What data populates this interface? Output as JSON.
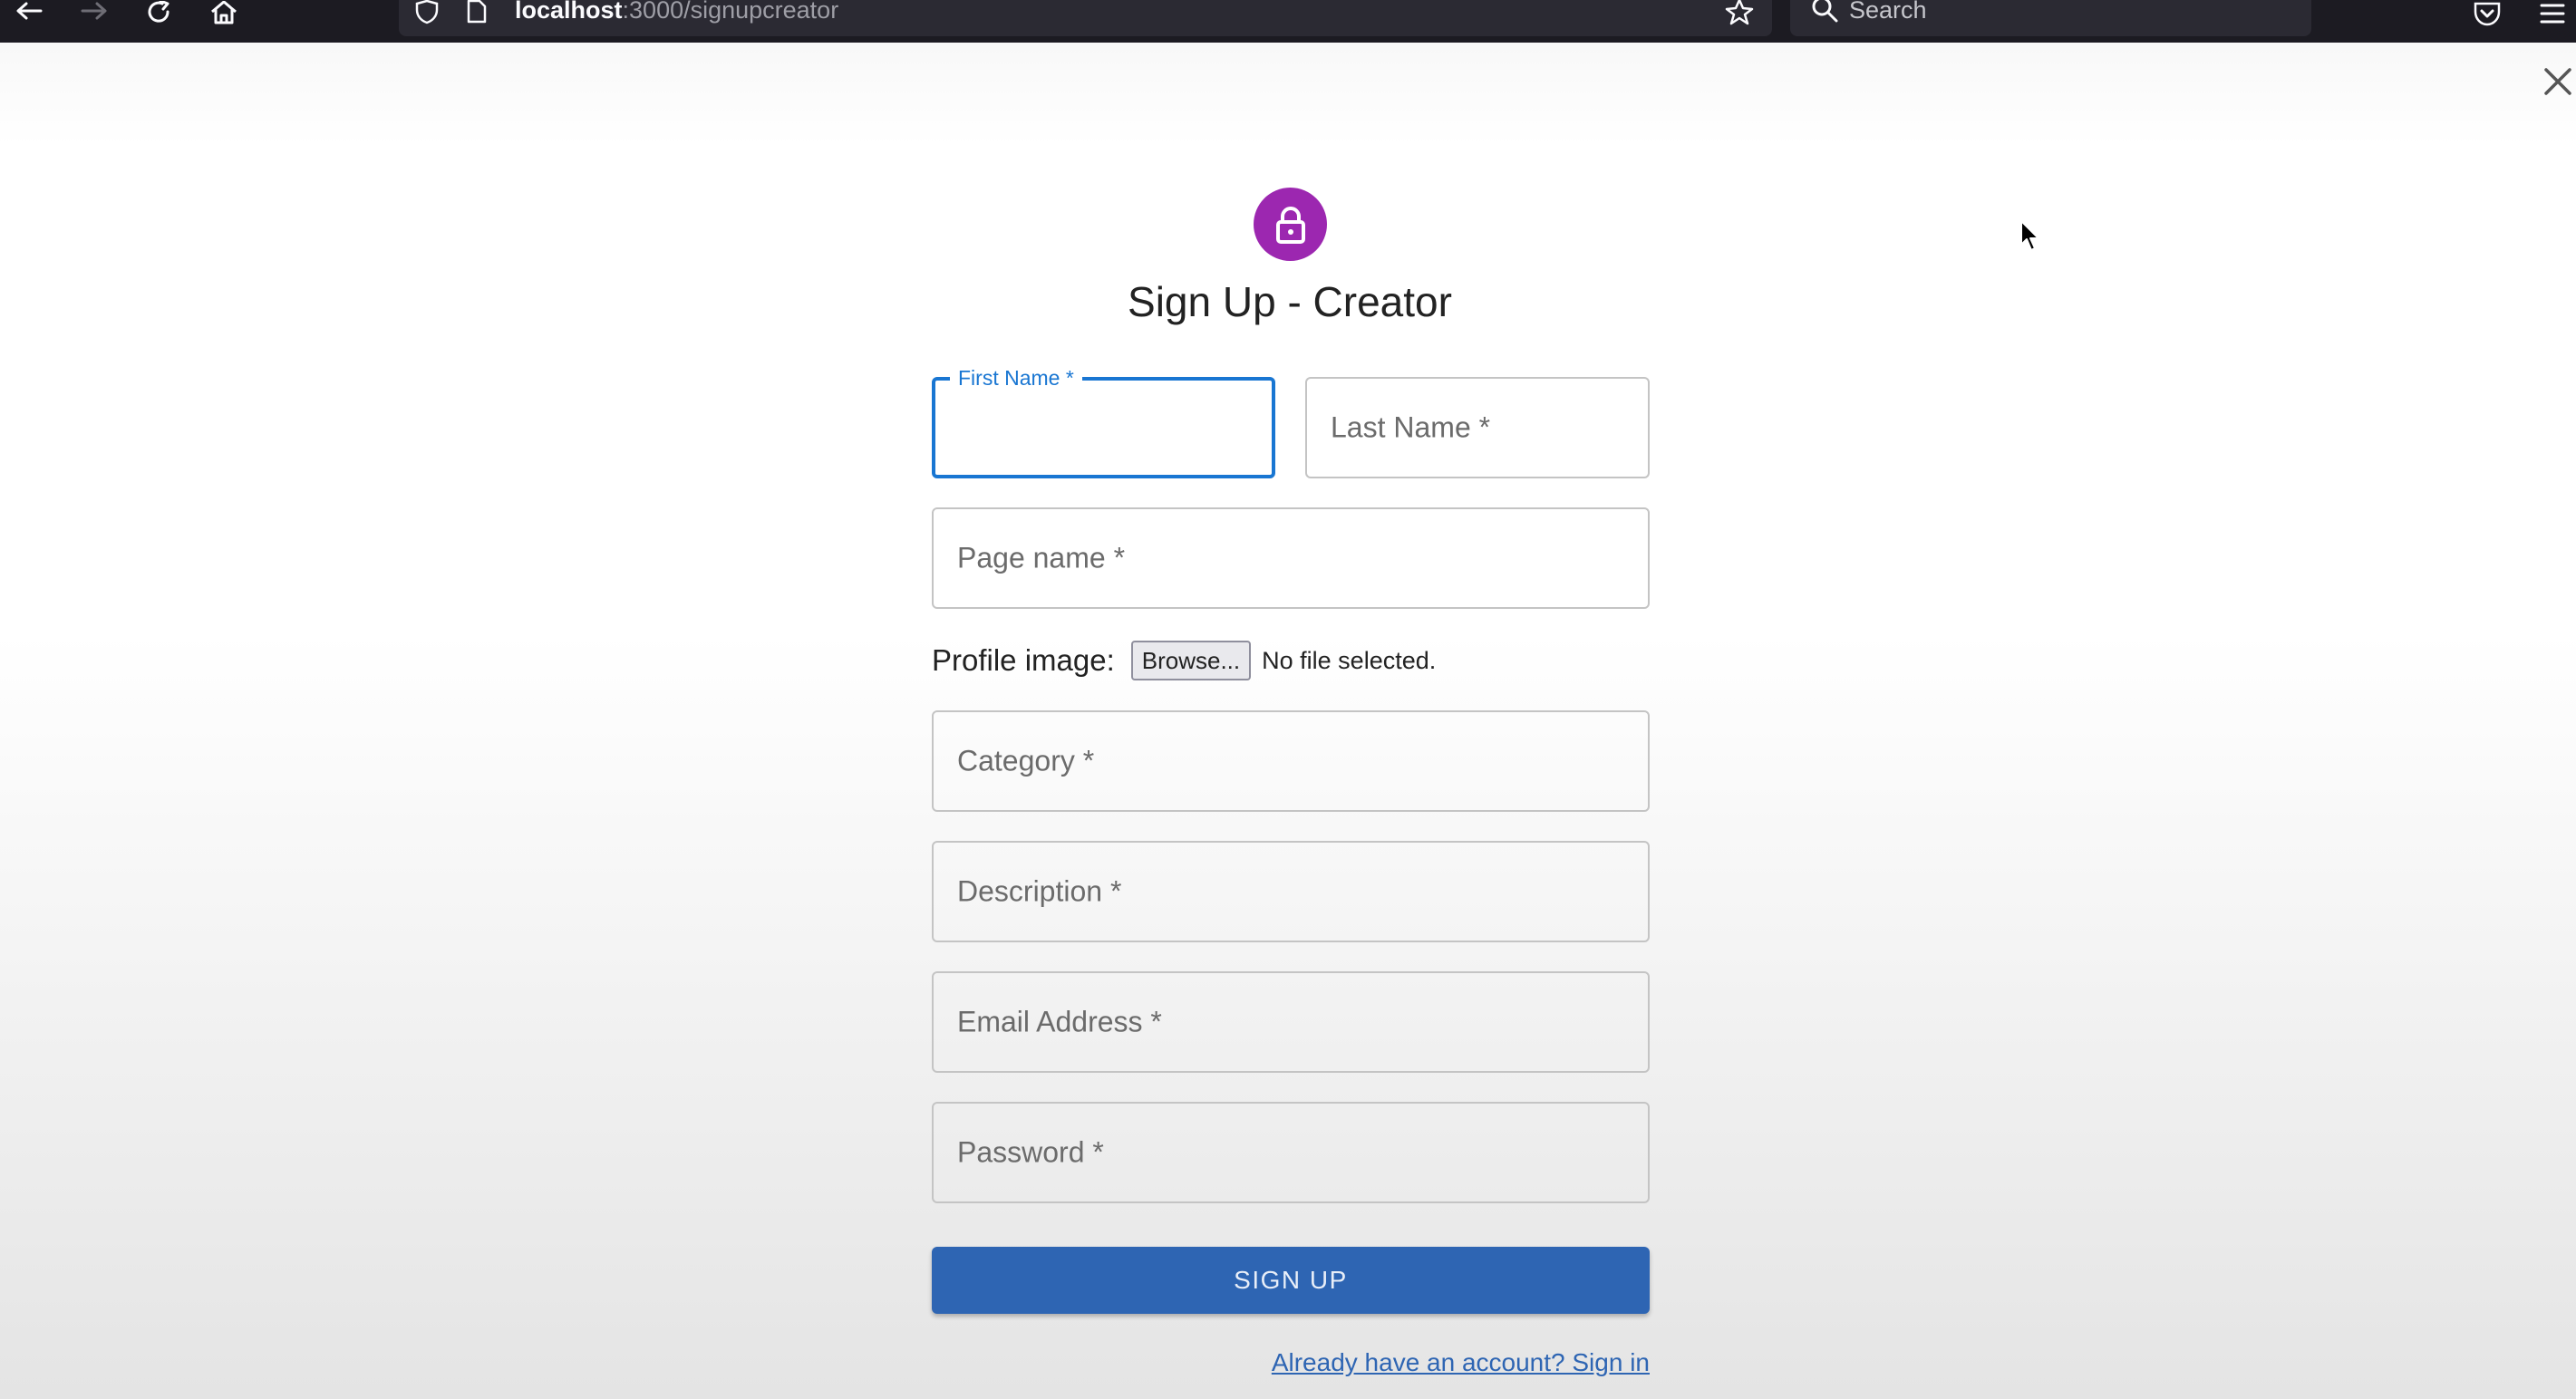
{
  "browser": {
    "url_host": "localhost",
    "url_path": ":3000/signupcreator",
    "search_placeholder": "Search"
  },
  "form": {
    "title": "Sign Up - Creator",
    "first_name_label": "First Name *",
    "last_name_label": "Last Name *",
    "page_name_label": "Page name *",
    "profile_image_label": "Profile image:",
    "browse_label": "Browse...",
    "file_status": "No file selected.",
    "category_label": "Category *",
    "description_label": "Description *",
    "email_label": "Email Address *",
    "password_label": "Password *",
    "submit_label": "SIGN UP",
    "signin_link": "Already have an account? Sign in"
  },
  "colors": {
    "accent_purple": "#9c27b0",
    "primary_blue": "#2e65b3",
    "focus_blue": "#1976d2",
    "toolbar_bg": "#1c1b22"
  },
  "icons": [
    "back-icon",
    "forward-icon",
    "reload-icon",
    "home-icon",
    "shield-icon",
    "page-icon",
    "star-icon",
    "search-icon",
    "pocket-icon",
    "menu-icon",
    "close-icon",
    "lock-icon",
    "cursor-icon"
  ]
}
